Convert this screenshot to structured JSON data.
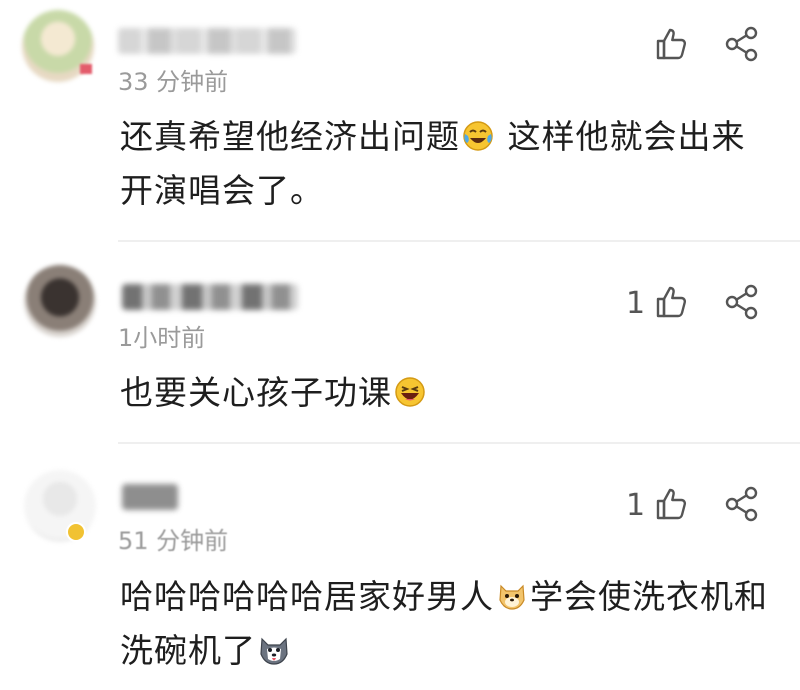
{
  "comments": [
    {
      "time": "33 分钟前",
      "like_count": "",
      "text_a": "还真希望他经济出问题",
      "emoji_a": "crying-laughing-emoji",
      "text_b": " 这样他就会出来开演唱会了。"
    },
    {
      "time": "1小时前",
      "like_count": "1",
      "text_a": "也要关心孩子功课",
      "emoji_a": "laughing-emoji"
    },
    {
      "time": "51 分钟前",
      "like_count": "1",
      "text_a": "哈哈哈哈哈哈居家好男人",
      "emoji_a": "doge-emoji",
      "text_b": "学会使洗衣机和洗碗机了",
      "emoji_b": "husky-emoji"
    }
  ],
  "icons": {
    "like": "thumbs-up-icon",
    "share": "share-icon"
  },
  "colors": {
    "text": "#1e1e1e",
    "meta": "#9a9a9a",
    "icon": "#555555",
    "divider": "#efefef"
  }
}
